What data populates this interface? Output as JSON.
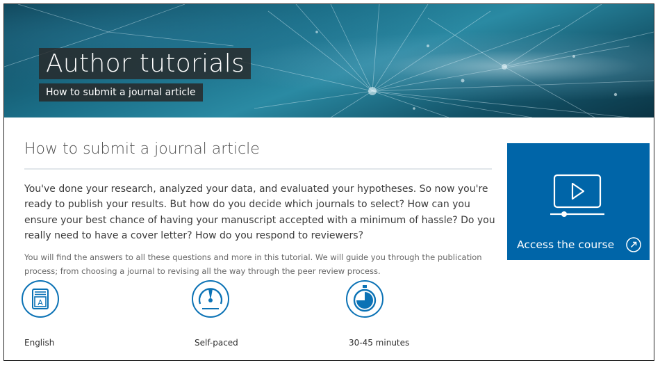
{
  "banner": {
    "title": "Author tutorials",
    "subtitle": "How to submit a journal article"
  },
  "main": {
    "heading": "How to submit a journal article",
    "lead": "You've done your research, analyzed your data, and evaluated your hypotheses. So now you're ready to publish your results. But how do you decide which journals to select? How can you ensure your best chance of having your manuscript accepted with a minimum of hassle? Do you really need to have a cover letter? How do you respond to reviewers?",
    "intro": "You will find the answers to all these questions and more in this tutorial. We will guide you through the publication process; from choosing a journal to revising all the way through the peer review process."
  },
  "features": [
    {
      "icon": "language-book-icon",
      "label": "English"
    },
    {
      "icon": "speedometer-icon",
      "label": "Self-paced"
    },
    {
      "icon": "stopwatch-icon",
      "label": "30-45 minutes"
    }
  ],
  "cta": {
    "label": "Access the course",
    "icon": "video-play-icon",
    "arrow_icon": "external-arrow-icon"
  },
  "colors": {
    "accent": "#0065a8",
    "icon_blue": "#0b72b5",
    "title_box": "#2b2b2b"
  }
}
